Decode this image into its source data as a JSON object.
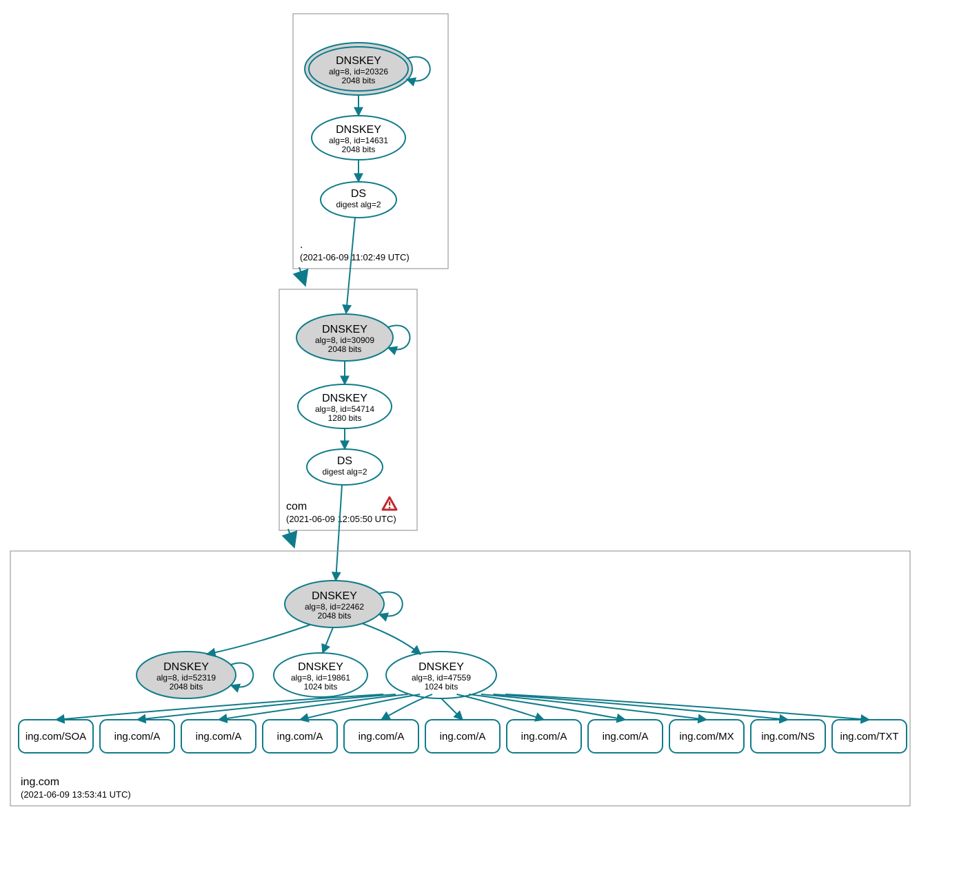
{
  "colors": {
    "stroke": "#0f7b8a",
    "zoneStroke": "#888",
    "keyFill": "#d3d3d3"
  },
  "zones": {
    "root": {
      "label": ".",
      "timestamp": "(2021-06-09 11:02:49 UTC)",
      "nodes": {
        "ksk": {
          "title": "DNSKEY",
          "l1": "alg=8, id=20326",
          "l2": "2048 bits"
        },
        "zsk": {
          "title": "DNSKEY",
          "l1": "alg=8, id=14631",
          "l2": "2048 bits"
        },
        "ds": {
          "title": "DS",
          "l1": "digest alg=2"
        }
      }
    },
    "com": {
      "label": "com",
      "timestamp": "(2021-06-09 12:05:50 UTC)",
      "warning": true,
      "nodes": {
        "ksk": {
          "title": "DNSKEY",
          "l1": "alg=8, id=30909",
          "l2": "2048 bits"
        },
        "zsk": {
          "title": "DNSKEY",
          "l1": "alg=8, id=54714",
          "l2": "1280 bits"
        },
        "ds": {
          "title": "DS",
          "l1": "digest alg=2"
        }
      }
    },
    "ing": {
      "label": "ing.com",
      "timestamp": "(2021-06-09 13:53:41 UTC)",
      "nodes": {
        "ksk": {
          "title": "DNSKEY",
          "l1": "alg=8, id=22462",
          "l2": "2048 bits"
        },
        "sk2": {
          "title": "DNSKEY",
          "l1": "alg=8, id=52319",
          "l2": "2048 bits"
        },
        "sk3": {
          "title": "DNSKEY",
          "l1": "alg=8, id=19861",
          "l2": "1024 bits"
        },
        "zsk": {
          "title": "DNSKEY",
          "l1": "alg=8, id=47559",
          "l2": "1024 bits"
        }
      },
      "rrsets": [
        "ing.com/SOA",
        "ing.com/A",
        "ing.com/A",
        "ing.com/A",
        "ing.com/A",
        "ing.com/A",
        "ing.com/A",
        "ing.com/A",
        "ing.com/MX",
        "ing.com/NS",
        "ing.com/TXT"
      ]
    }
  }
}
